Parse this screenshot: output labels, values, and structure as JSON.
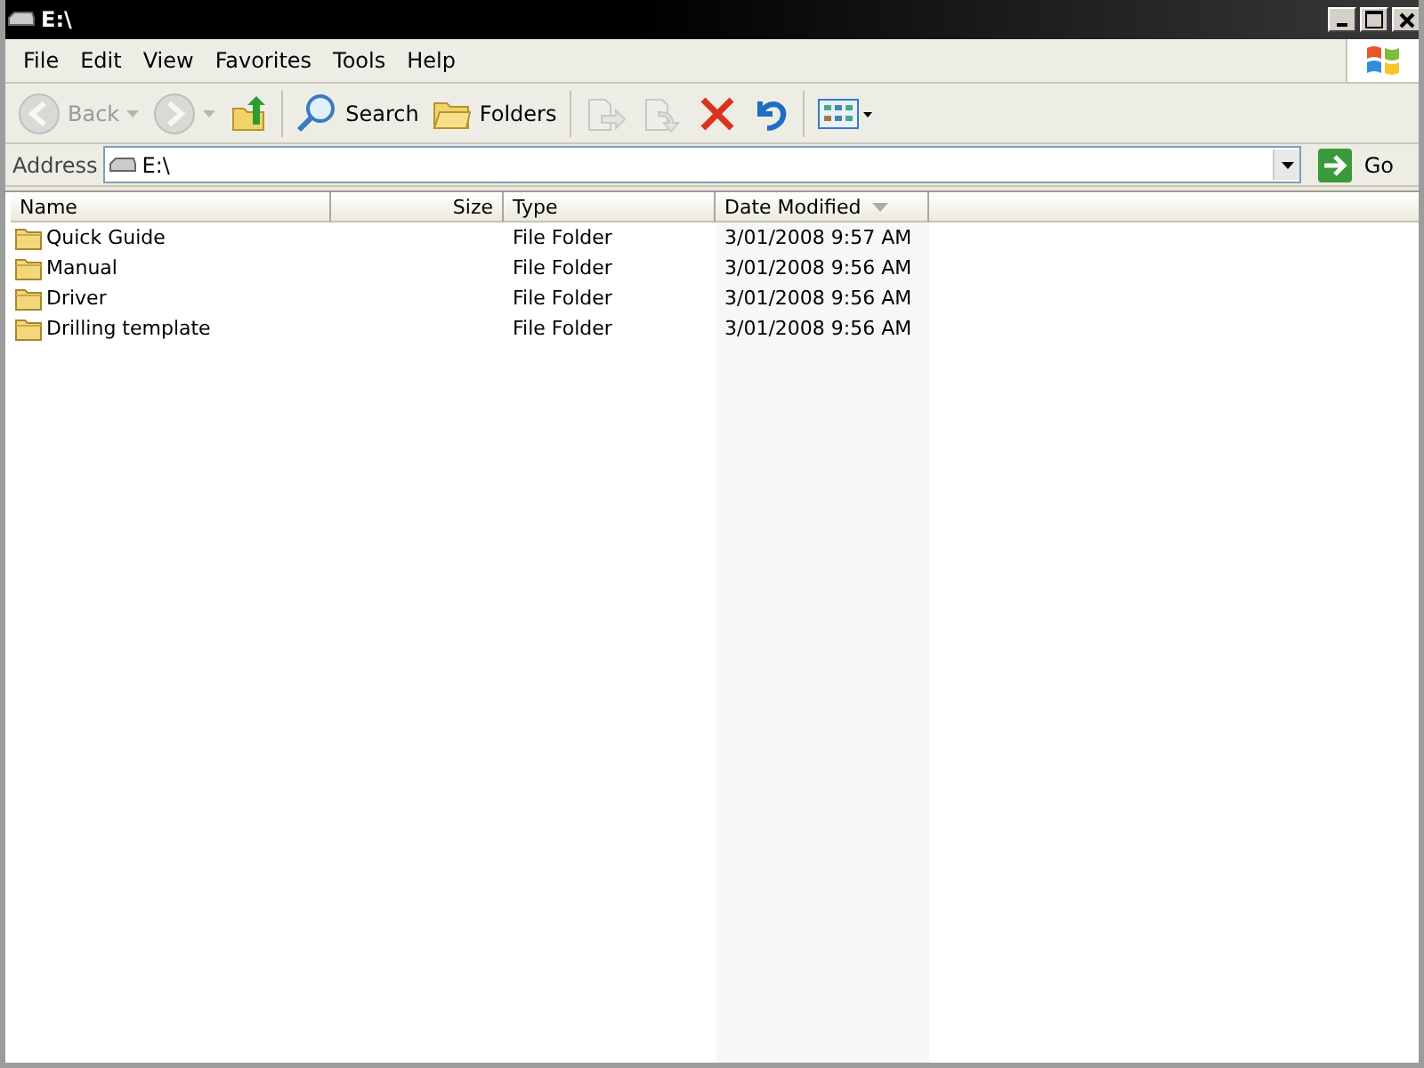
{
  "window": {
    "title": "E:\\"
  },
  "menu": [
    "File",
    "Edit",
    "View",
    "Favorites",
    "Tools",
    "Help"
  ],
  "toolbar": [
    {
      "kind": "back",
      "label": "Back",
      "disabled": true
    },
    {
      "kind": "forward",
      "disabled": true
    },
    {
      "kind": "up",
      "disabled": false
    },
    {
      "kind": "search",
      "label": "Search",
      "disabled": false
    },
    {
      "kind": "folders",
      "label": "Folders",
      "disabled": false
    },
    {
      "kind": "move",
      "disabled": true
    },
    {
      "kind": "copy",
      "disabled": true
    },
    {
      "kind": "delete",
      "disabled": false
    },
    {
      "kind": "undo",
      "disabled": false
    },
    {
      "kind": "views",
      "disabled": false
    }
  ],
  "address": {
    "label": "Address",
    "value": "E:\\",
    "go": "Go"
  },
  "table": {
    "columns": [
      {
        "label": "Name",
        "sorted": false
      },
      {
        "label": "Size",
        "sorted": false
      },
      {
        "label": "Type",
        "sorted": false
      },
      {
        "label": "Date Modified",
        "sorted": true
      }
    ],
    "rows": [
      {
        "name": "Quick Guide",
        "type": "File Folder",
        "date": "3/01/2008 9:57 AM"
      },
      {
        "name": "Manual",
        "type": "File Folder",
        "date": "3/01/2008 9:56 AM"
      },
      {
        "name": "Driver",
        "type": "File Folder",
        "date": "3/01/2008 9:56 AM"
      },
      {
        "name": "Drilling template",
        "type": "File Folder",
        "date": "3/01/2008 9:56 AM"
      }
    ]
  }
}
